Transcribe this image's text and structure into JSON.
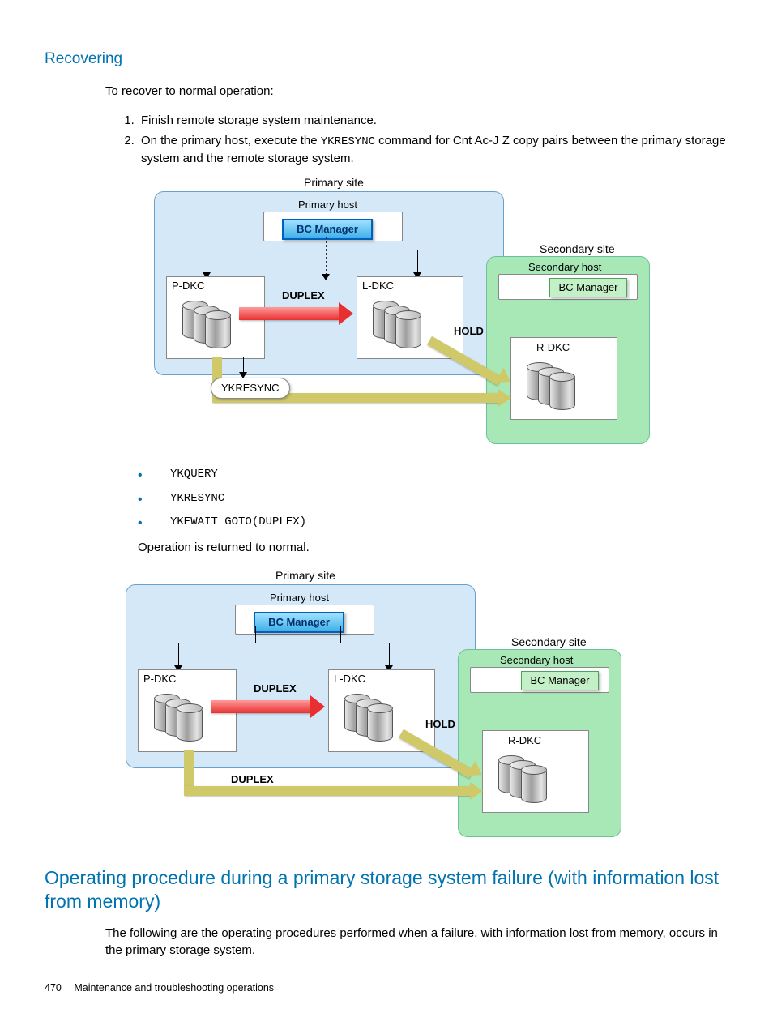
{
  "headings": {
    "recovering": "Recovering",
    "operating_procedure": "Operating procedure during a primary storage system failure (with information lost from memory)"
  },
  "intro": "To recover to normal operation:",
  "steps": {
    "s1": "Finish remote storage system maintenance.",
    "s2_pre": "On the primary host, execute the ",
    "s2_cmd": "YKRESYNC",
    "s2_post": " command for Cnt Ac-J Z copy pairs between the primary storage system and the remote storage system."
  },
  "bullets": {
    "b1": "YKQUERY",
    "b2": "YKRESYNC",
    "b3": "YKEWAIT GOTO(DUPLEX)"
  },
  "returned_normal": "Operation is returned to normal.",
  "operating_body": "The following are the operating procedures performed when a failure, with information lost from memory, occurs in the primary storage system.",
  "footer": {
    "page": "470",
    "chapter": "Maintenance and troubleshooting operations"
  },
  "diagram": {
    "primary_site": "Primary site",
    "primary_host": "Primary host",
    "secondary_site": "Secondary site",
    "secondary_host": "Secondary host",
    "bc_manager": "BC Manager",
    "p_dkc": "P-DKC",
    "l_dkc": "L-DKC",
    "r_dkc": "R-DKC",
    "duplex": "DUPLEX",
    "hold": "HOLD",
    "ykresync": "YKRESYNC"
  }
}
